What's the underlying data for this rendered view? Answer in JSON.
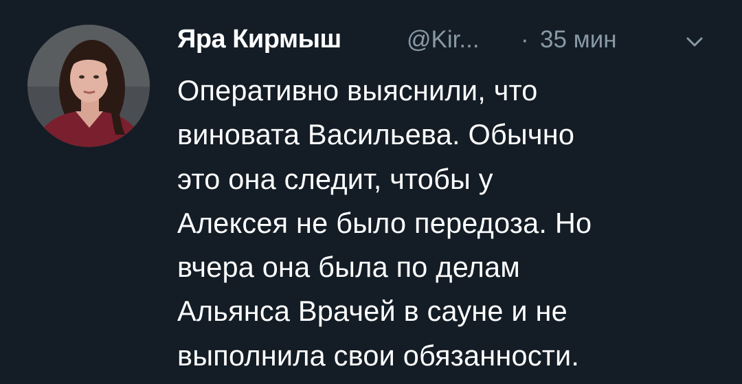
{
  "tweet": {
    "author_name": "Яра Кирмыш",
    "author_handle": "@Kir...",
    "separator": "·",
    "timestamp": "35 мин",
    "text_lines": [
      "Оперативно выяснили, что",
      "виновата Васильева. Обычно",
      "это она следит, чтобы у",
      "Алексея не было передоза. Но",
      "вчера она была по делам",
      "Альянса Врачей в сауне и не",
      "выполнила свои обязанности."
    ]
  },
  "colors": {
    "background": "#141d26",
    "text": "#ffffff",
    "muted": "#8899a6"
  },
  "icons": {
    "avatar": "profile-photo",
    "menu": "chevron-down-icon"
  }
}
